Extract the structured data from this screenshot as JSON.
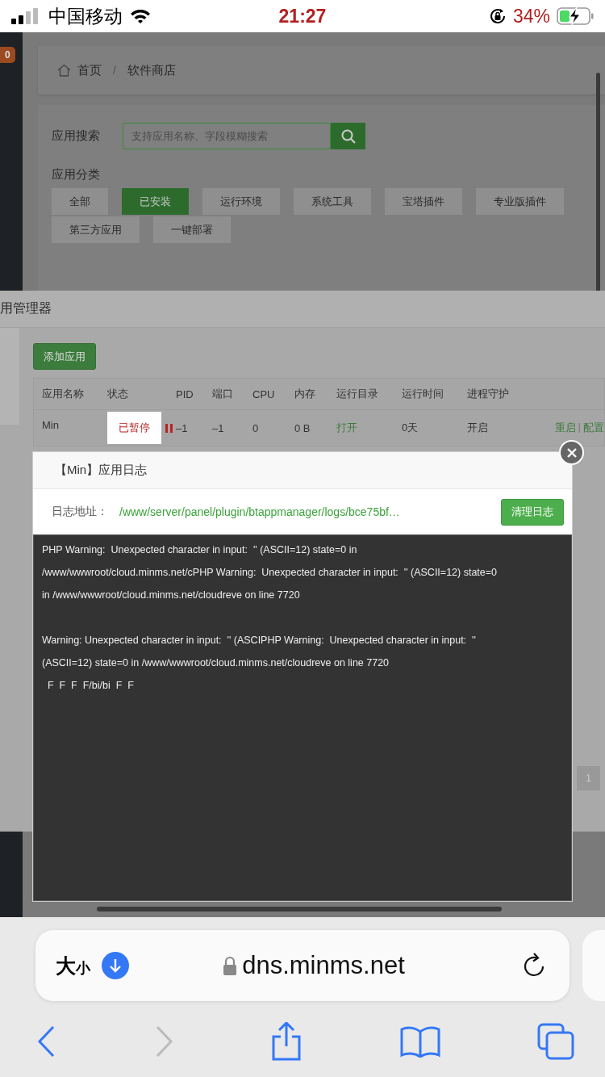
{
  "status_bar": {
    "carrier": "中国移动",
    "time": "21:27",
    "battery": "34%"
  },
  "sidebar": {
    "badge": "0"
  },
  "breadcrumb": [
    "首页",
    "软件商店"
  ],
  "breadcrumb_separator": "/",
  "search": {
    "label": "应用搜索",
    "placeholder": "支持应用名称、字段模糊搜索"
  },
  "categories": {
    "label": "应用分类",
    "items": [
      {
        "label": "全部",
        "selected": false
      },
      {
        "label": "已安装",
        "selected": true
      },
      {
        "label": "运行环境",
        "selected": false
      },
      {
        "label": "系统工具",
        "selected": false
      },
      {
        "label": "宝塔插件",
        "selected": false
      },
      {
        "label": "专业版插件",
        "selected": false
      },
      {
        "label": "第三方应用",
        "selected": false
      },
      {
        "label": "一键部署",
        "selected": false
      }
    ]
  },
  "manager": {
    "title": "用管理器",
    "add_button": "添加应用",
    "columns": [
      "应用名称",
      "状态",
      "PID",
      "端口",
      "CPU",
      "内存",
      "运行目录",
      "运行时间",
      "进程守护"
    ],
    "rows": [
      {
        "name": "Min",
        "status": "已暂停",
        "paused": true,
        "pid": "–1",
        "port": "–1",
        "cpu": "0",
        "memory": "0 B",
        "directory": "打开",
        "uptime": "0天",
        "guard": "开启",
        "actions": [
          "重启",
          "配置"
        ],
        "action_separator": "|"
      }
    ],
    "pagination": "1"
  },
  "log_dialog": {
    "title": "【Min】应用日志",
    "path_label": "日志地址：",
    "path": "/www/server/panel/plugin/btappmanager/logs/bce75bf…",
    "clear_button": "清理日志",
    "blocks": [
      [
        "PHP Warning:  Unexpected character in input:  '' (ASCII=12) state=0 in",
        "/www/wwwroot/cloud.minms.net/cPHP Warning:  Unexpected character in input:  '' (ASCII=12) state=0",
        "in /www/wwwroot/cloud.minms.net/cloudreve on line 7720"
      ],
      [
        "Warning: Unexpected character in input:  '' (ASCIPHP Warning:  Unexpected character in input:  ''",
        "(ASCII=12) state=0 in /www/wwwroot/cloud.minms.net/cloudreve on line 7720",
        "  F  F  F  F/bi/bi  F  F"
      ]
    ]
  },
  "browser": {
    "text_size": "大小",
    "url": "dns.minms.net"
  }
}
